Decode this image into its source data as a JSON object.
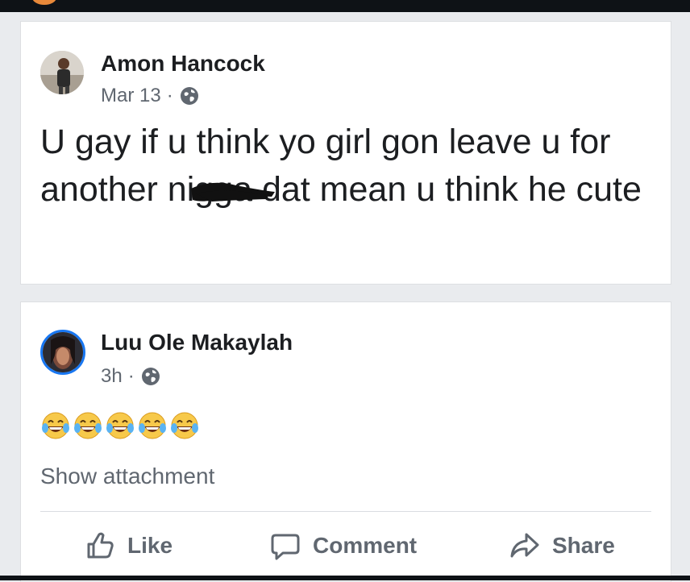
{
  "post": {
    "author": "Amon Hancock",
    "date": "Mar 13",
    "separator": "·",
    "text_before": "U gay if u think yo girl gon leave u for another ni",
    "text_redacted": "gga",
    "text_after": " dat mean u think he cute"
  },
  "comment": {
    "author": "Luu Ole Makaylah",
    "time": "3h",
    "separator": "·",
    "emoji_count": 5,
    "show_attachment": "Show attachment"
  },
  "actions": {
    "like": "Like",
    "comment": "Comment",
    "share": "Share"
  },
  "colors": {
    "background": "#e9ebee",
    "card": "#ffffff",
    "text": "#1c1e21",
    "secondary": "#606770",
    "emoji_face": "#f7c94a",
    "comment_avatar_ring": "#1877f2"
  },
  "icons": {
    "privacy": "globe-icon",
    "like": "thumbs-up-icon",
    "comment": "speech-bubble-icon",
    "share": "share-arrow-icon",
    "reaction": "tears-of-joy-emoji"
  }
}
